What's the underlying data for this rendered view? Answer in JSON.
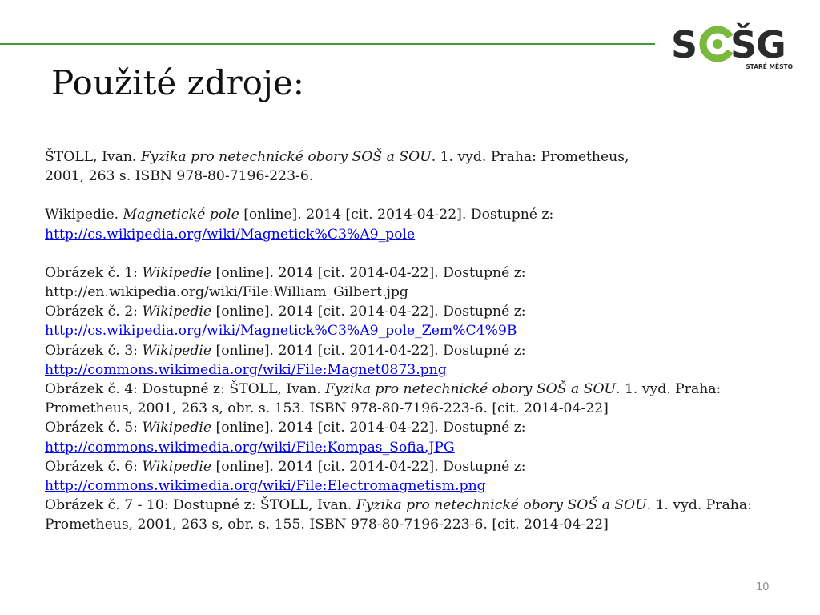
{
  "slide": {
    "title": "Použité zdroje:",
    "page_number": "10"
  },
  "logo": {
    "text_s1": "S",
    "text_s2": "Š",
    "text_g": "G",
    "subtitle": "STARÉ MĚSTO",
    "colors": {
      "dark": "#2b2b2b",
      "green": "#7ab93e"
    }
  },
  "colors": {
    "accent_line": "#3f9a3f",
    "link": "#0000ee"
  },
  "references": [
    {
      "pre": "ŠTOLL, Ivan. ",
      "italic": "Fyzika pro netechnické obory SOŠ a SOU",
      "post": ". 1. vyd. Praha: Prometheus,",
      "line2": "2001, 263 s. ISBN 978-80-7196-223-6."
    },
    {
      "pre": "Wikipedie. ",
      "italic": "Magnetické pole",
      "post": " [online]. 2014 [cit. 2014-04-22]. Dostupné z:",
      "link": "http://cs.wikipedia.org/wiki/Magnetick%C3%A9_pole"
    },
    {
      "pre": "Obrázek č. 1: ",
      "italic": "Wikipedie",
      "post": " [online]. 2014 [cit. 2014-04-22]. Dostupné z:",
      "line2": "http://en.wikipedia.org/wiki/File:William_Gilbert.jpg"
    },
    {
      "pre": "Obrázek č. 2: ",
      "italic": "Wikipedie",
      "post": " [online]. 2014 [cit. 2014-04-22]. Dostupné z:",
      "link": "http://cs.wikipedia.org/wiki/Magnetick%C3%A9_pole_Zem%C4%9B"
    },
    {
      "pre": "Obrázek č. 3: ",
      "italic": "Wikipedie",
      "post": " [online]. 2014 [cit. 2014-04-22]. Dostupné z:",
      "link": "http://commons.wikimedia.org/wiki/File:Magnet0873.png"
    },
    {
      "pre": "Obrázek č. 4: Dostupné z: ŠTOLL, Ivan. ",
      "italic": "Fyzika pro netechnické obory SOŠ a SOU",
      "post": ". 1. vyd. Praha:",
      "line2": "Prometheus, 2001, 263 s, obr. s. 153. ISBN 978-80-7196-223-6. [cit. 2014-04-22]"
    },
    {
      "pre": "Obrázek č. 5: ",
      "italic": "Wikipedie",
      "post": " [online]. 2014 [cit. 2014-04-22]. Dostupné z:",
      "link": "http://commons.wikimedia.org/wiki/File:Kompas_Sofia.JPG"
    },
    {
      "pre": "Obrázek č. 6: ",
      "italic": "Wikipedie",
      "post": " [online]. 2014 [cit. 2014-04-22]. Dostupné z:",
      "link": "http://commons.wikimedia.org/wiki/File:Electromagnetism.png"
    },
    {
      "pre": "Obrázek č. 7 - 10: Dostupné z: ŠTOLL, Ivan. ",
      "italic": "Fyzika pro netechnické obory SOŠ a SOU",
      "post": ". 1. vyd. Praha:",
      "line2": "Prometheus, 2001, 263 s, obr. s. 155. ISBN 978-80-7196-223-6. [cit. 2014-04-22]"
    }
  ]
}
